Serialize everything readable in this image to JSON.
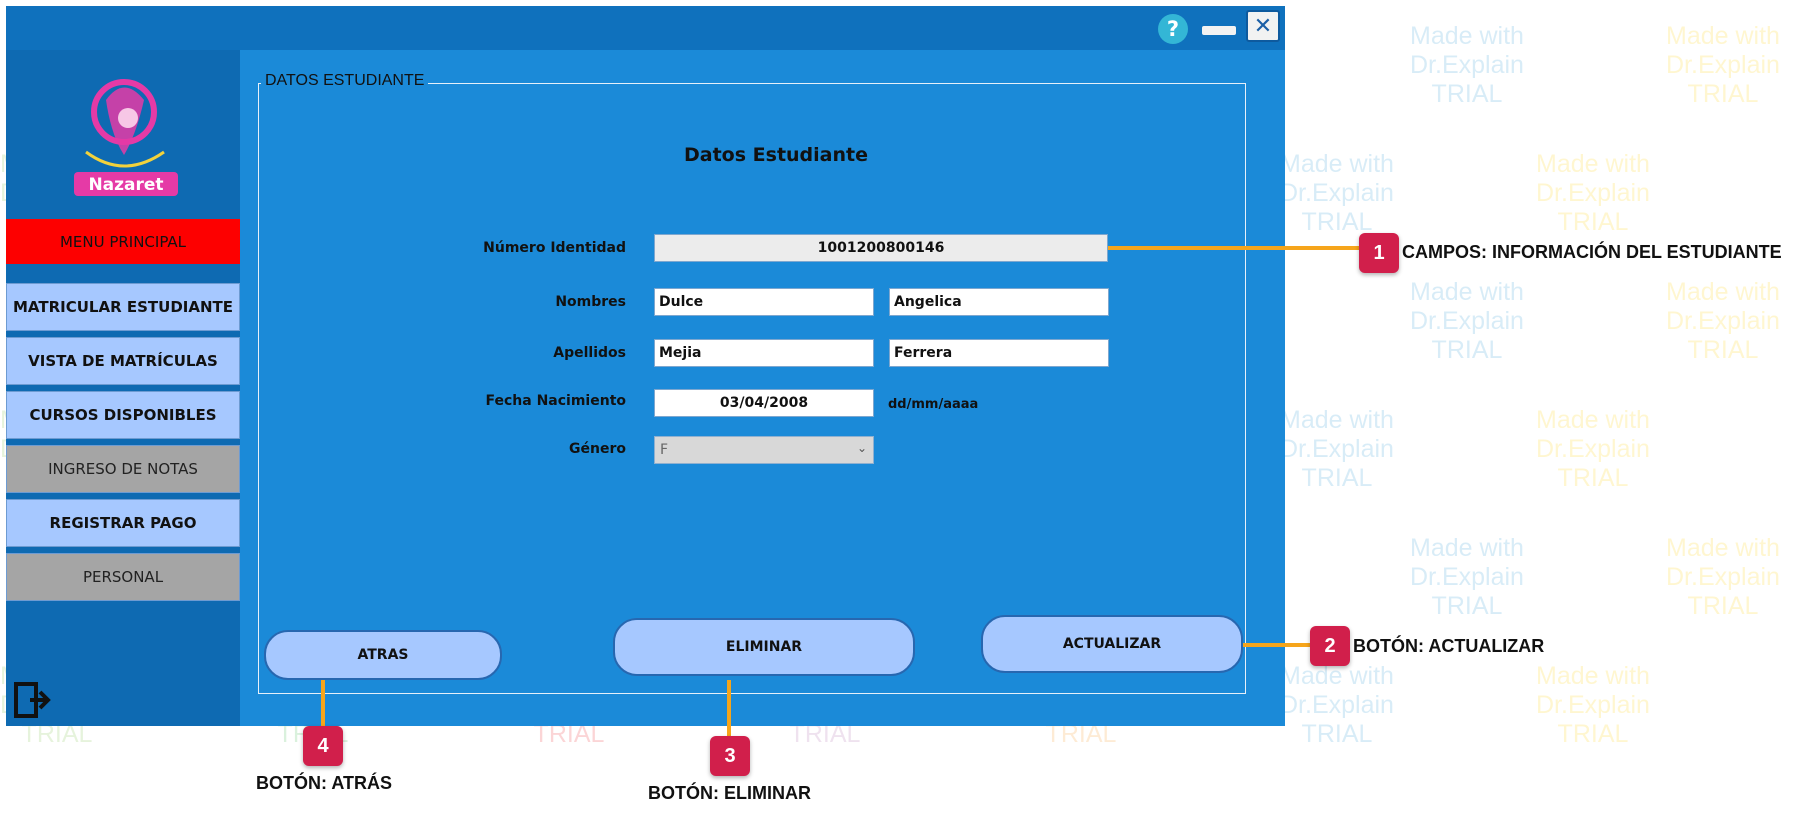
{
  "watermark": {
    "line1": "Made with",
    "line2": "Dr.Explain",
    "line3": "TRIAL"
  },
  "window": {
    "help_icon": "question-circle-icon",
    "minimize_icon": "minimize-icon",
    "close_icon": "close-icon",
    "help_glyph": "?",
    "close_glyph": "✕"
  },
  "brand": {
    "logo_text": "Nazaret"
  },
  "sidebar": {
    "header": "MENU PRINCIPAL",
    "items": [
      {
        "label": "MATRICULAR ESTUDIANTE"
      },
      {
        "label": "VISTA DE MATRÍCULAS"
      },
      {
        "label": "CURSOS DISPONIBLES"
      },
      {
        "label": "INGRESO DE NOTAS"
      },
      {
        "label": "REGISTRAR PAGO"
      },
      {
        "label": "PERSONAL"
      }
    ],
    "exit_icon": "logout-icon"
  },
  "panel": {
    "title": "DATOS ESTUDIANTE"
  },
  "form": {
    "title": "Datos Estudiante",
    "id_label": "Número Identidad",
    "id_value": "1001200800146",
    "names_label": "Nombres",
    "first_name": "Dulce",
    "second_name": "Angelica",
    "surnames_label": "Apellidos",
    "first_surname": "Mejia",
    "second_surname": "Ferrera",
    "dob_label": "Fecha Nacimiento",
    "dob_value": "03/04/2008",
    "dob_hint": "dd/mm/aaaa",
    "gender_label": "Género",
    "gender_value": "F"
  },
  "buttons": {
    "back": "ATRAS",
    "delete": "ELIMINAR",
    "update": "ACTUALIZAR"
  },
  "callouts": {
    "c1": {
      "num": "1",
      "text": "CAMPOS: INFORMACIÓN DEL ESTUDIANTE"
    },
    "c2": {
      "num": "2",
      "text": "BOTÓN: ACTUALIZAR"
    },
    "c3": {
      "num": "3",
      "text": "BOTÓN: ELIMINAR"
    },
    "c4": {
      "num": "4",
      "text": "BOTÓN: ATRÁS"
    }
  },
  "colors": {
    "window_bg": "#1b8ad8",
    "menu_header": "#fd0000",
    "menu_button": "#a6c8ff",
    "menu_disabled": "#a5a5a5",
    "callout_badge": "#d11f4b",
    "callout_line": "#f6a51b"
  }
}
